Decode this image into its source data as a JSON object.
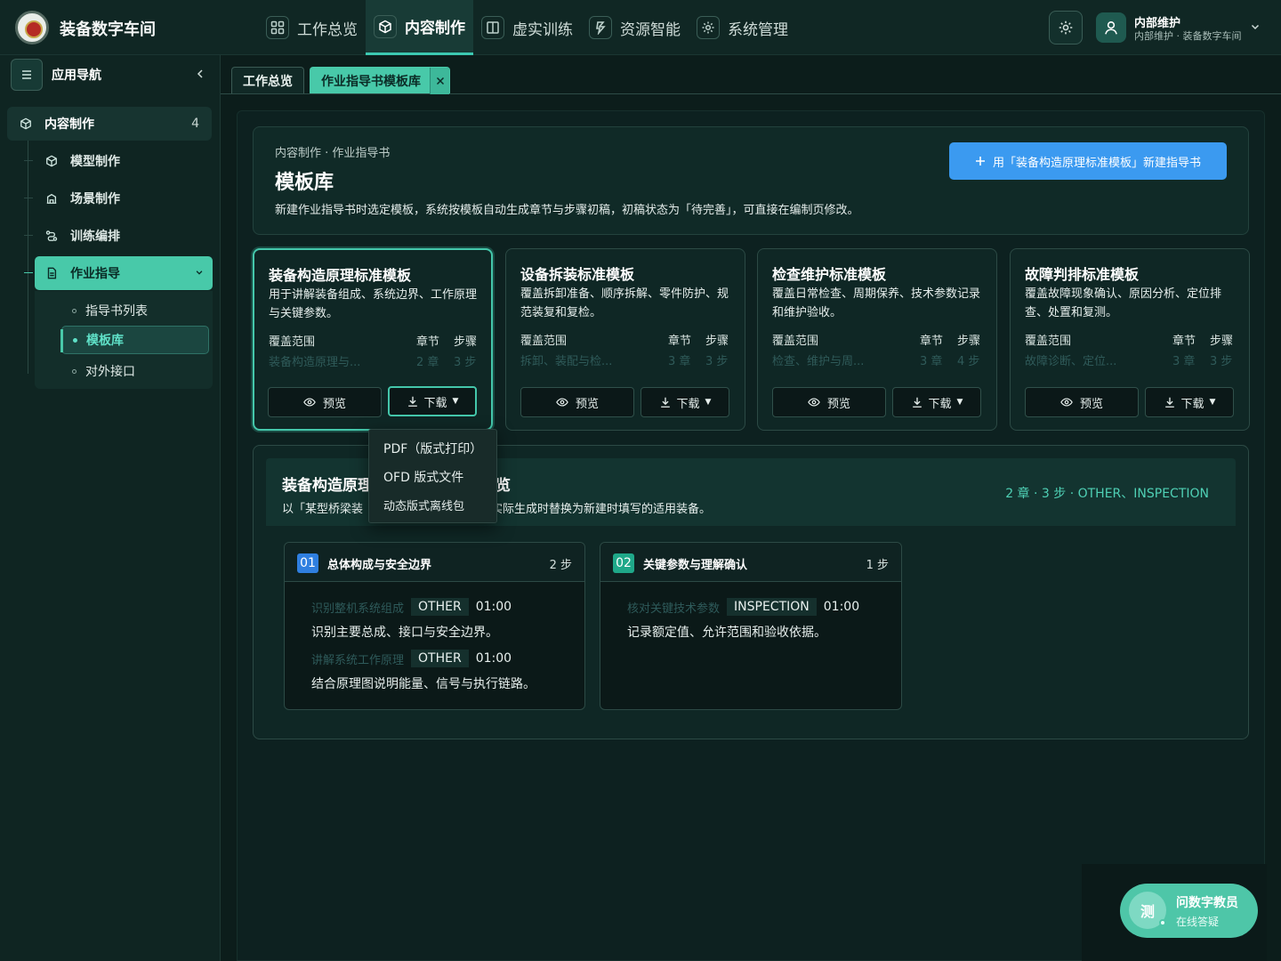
{
  "app": {
    "title": "装备数字车间"
  },
  "nav": [
    {
      "label": "工作总览",
      "icon": "grid-icon"
    },
    {
      "label": "内容制作",
      "icon": "cube-icon",
      "active": true
    },
    {
      "label": "虚实训练",
      "icon": "book-icon"
    },
    {
      "label": "资源智能",
      "icon": "bolt-icon"
    },
    {
      "label": "系统管理",
      "icon": "gear-icon"
    }
  ],
  "user": {
    "name": "内部维护",
    "sub": "内部维护 · 装备数字车间"
  },
  "sidebar": {
    "title": "应用导航",
    "group": {
      "label": "内容制作",
      "count": "4"
    },
    "items": [
      {
        "label": "模型制作"
      },
      {
        "label": "场景制作"
      },
      {
        "label": "训练编排"
      },
      {
        "label": "作业指导"
      }
    ],
    "subitems": [
      {
        "label": "指导书列表"
      },
      {
        "label": "模板库"
      },
      {
        "label": "对外接口"
      }
    ]
  },
  "tabs": [
    {
      "label": "工作总览"
    },
    {
      "label": "作业指导书模板库"
    }
  ],
  "hero": {
    "crumb": "内容制作 · 作业指导书",
    "title": "模板库",
    "desc": "新建作业指导书时选定模板，系统按模板自动生成章节与步骤初稿，初稿状态为「待完善」，可直接在编制页修改。",
    "new_button": "用「装备构造原理标准模板」新建指导书"
  },
  "card_labels": {
    "scope": "覆盖范围",
    "chapters": "章节",
    "steps": "步骤",
    "preview": "预览",
    "download": "下载"
  },
  "cards": [
    {
      "title": "装备构造原理标准模板",
      "desc": "用于讲解装备组成、系统边界、工作原理与关键参数。",
      "scope": "装备构造原理与...",
      "chapters": "2 章",
      "steps": "3 步"
    },
    {
      "title": "设备拆装标准模板",
      "desc": "覆盖拆卸准备、顺序拆解、零件防护、规范装复和复检。",
      "scope": "拆卸、装配与检...",
      "chapters": "3 章",
      "steps": "3 步"
    },
    {
      "title": "检查维护标准模板",
      "desc": "覆盖日常检查、周期保养、技术参数记录和维护验收。",
      "scope": "检查、维护与周...",
      "chapters": "3 章",
      "steps": "4 步"
    },
    {
      "title": "故障判排标准模板",
      "desc": "覆盖故障现象确认、原因分析、定位排查、处置和复测。",
      "scope": "故障诊断、定位...",
      "chapters": "3 章",
      "steps": "3 步"
    }
  ],
  "preview": {
    "title_a": "装备构造原理",
    "title_b": "览",
    "desc_a": "以「某型桥梁装",
    "desc_b": "实际生成时替换为新建时填写的适用装备。",
    "meta": "2 章 · 3 步 · OTHER、INSPECTION",
    "chapters": [
      {
        "num": "01",
        "title": "总体构成与安全边界",
        "steps_label": "2 步",
        "color": "#2f7fe0",
        "steps": [
          {
            "name": "识别整机系统组成",
            "tag": "OTHER",
            "time": "01:00",
            "desc": "识别主要总成、接口与安全边界。"
          },
          {
            "name": "讲解系统工作原理",
            "tag": "OTHER",
            "time": "01:00",
            "desc": "结合原理图说明能量、信号与执行链路。"
          }
        ]
      },
      {
        "num": "02",
        "title": "关键参数与理解确认",
        "steps_label": "1 步",
        "color": "#1fa889",
        "steps": [
          {
            "name": "核对关键技术参数",
            "tag": "INSPECTION",
            "time": "01:00",
            "desc": "记录额定值、允许范围和验收依据。"
          }
        ]
      }
    ]
  },
  "dropdown": [
    "PDF（版式打印）",
    "OFD 版式文件",
    "动态版式离线包"
  ],
  "assistant": {
    "avatar": "测",
    "name": "问数字教员",
    "sub": "在线答疑"
  }
}
